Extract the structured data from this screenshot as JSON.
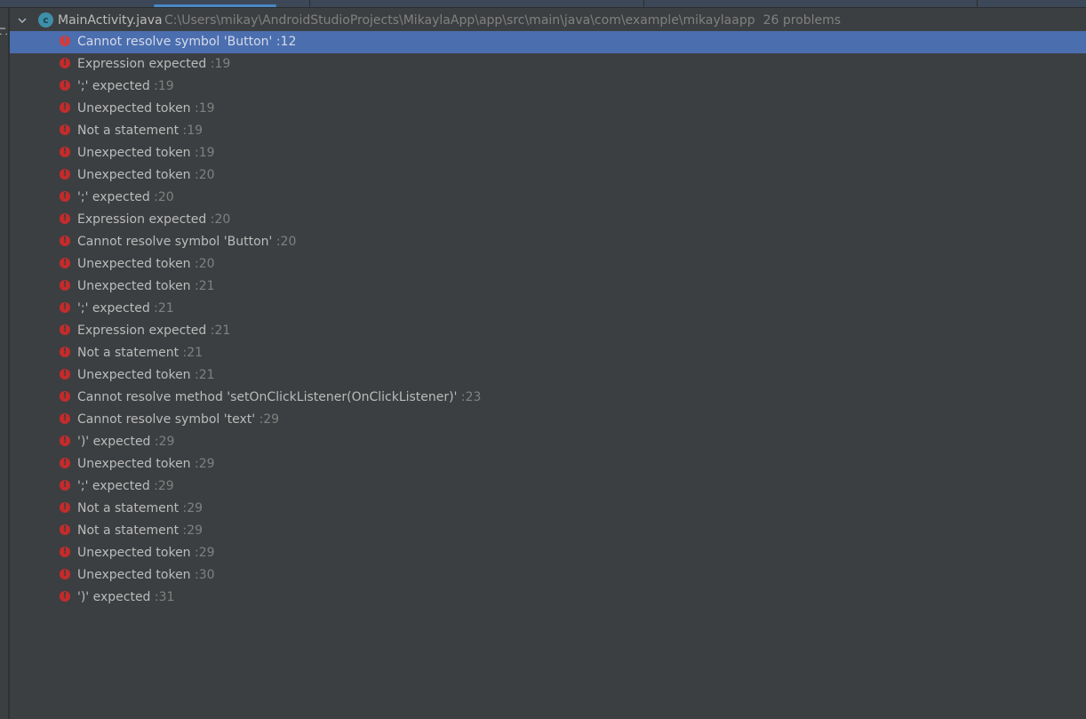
{
  "colors": {
    "background": "#3c3f41",
    "selection": "#4b6eaf",
    "error": "#c42b2b",
    "class_icon": "#3f8fa8",
    "tab_underline": "#4a88c7",
    "text": "#bbbbbb",
    "muted_text": "#808080"
  },
  "tabstrip": {
    "selected_tab_index": 0
  },
  "left_toolbar": {
    "icon": "collapse-arrow-icon"
  },
  "file_node": {
    "expand_icon": "chevron-down-icon",
    "file_type_icon": "java-class-icon",
    "file_type_glyph": "c",
    "file_name": "MainActivity.java",
    "path": "C:\\Users\\mikay\\AndroidStudioProjects\\MikaylaApp\\app\\src\\main\\java\\com\\example\\mikaylaapp",
    "problem_count": "26 problems"
  },
  "problems": [
    {
      "message": "Cannot resolve symbol 'Button'",
      "line": ":12",
      "selected": true
    },
    {
      "message": "Expression expected",
      "line": ":19"
    },
    {
      "message": "';' expected",
      "line": ":19"
    },
    {
      "message": "Unexpected token",
      "line": ":19"
    },
    {
      "message": "Not a statement",
      "line": ":19"
    },
    {
      "message": "Unexpected token",
      "line": ":19"
    },
    {
      "message": "Unexpected token",
      "line": ":20"
    },
    {
      "message": "';' expected",
      "line": ":20"
    },
    {
      "message": "Expression expected",
      "line": ":20"
    },
    {
      "message": "Cannot resolve symbol 'Button'",
      "line": ":20"
    },
    {
      "message": "Unexpected token",
      "line": ":20"
    },
    {
      "message": "Unexpected token",
      "line": ":21"
    },
    {
      "message": "';' expected",
      "line": ":21"
    },
    {
      "message": "Expression expected",
      "line": ":21"
    },
    {
      "message": "Not a statement",
      "line": ":21"
    },
    {
      "message": "Unexpected token",
      "line": ":21"
    },
    {
      "message": "Cannot resolve method 'setOnClickListener(OnClickListener)'",
      "line": ":23"
    },
    {
      "message": "Cannot resolve symbol 'text'",
      "line": ":29"
    },
    {
      "message": "')' expected",
      "line": ":29"
    },
    {
      "message": "Unexpected token",
      "line": ":29"
    },
    {
      "message": "';' expected",
      "line": ":29"
    },
    {
      "message": "Not a statement",
      "line": ":29"
    },
    {
      "message": "Not a statement",
      "line": ":29"
    },
    {
      "message": "Unexpected token",
      "line": ":29"
    },
    {
      "message": "Unexpected token",
      "line": ":30"
    },
    {
      "message": "')' expected",
      "line": ":31"
    }
  ]
}
